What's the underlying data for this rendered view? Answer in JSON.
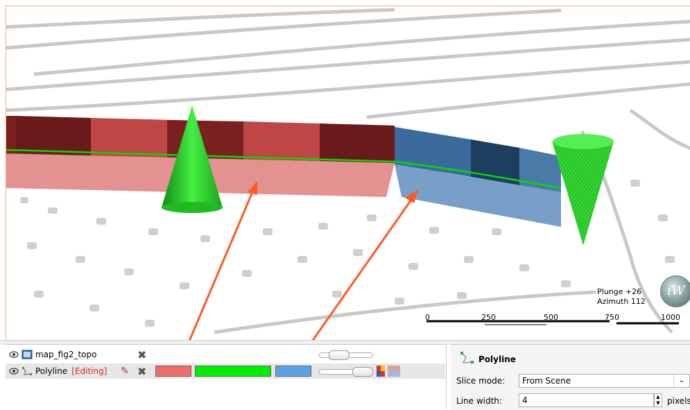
{
  "scene": {
    "compass": {
      "plunge": "Plunge +26",
      "azimuth": "Azimuth 112"
    },
    "scale_bar": {
      "labels": [
        "0",
        "250",
        "500",
        "750",
        "1000"
      ]
    },
    "logo_text": "iW",
    "colors": {
      "red_segment": "#c84a4a",
      "blue_segment": "#4a7aa8",
      "cone": "#22dd22",
      "annotation_arrow": "#ff5a1f"
    }
  },
  "layers": [
    {
      "name": "map_fig2_topo",
      "icon": "map-icon",
      "editing": ""
    },
    {
      "name": "Polyline",
      "icon": "polyline-icon",
      "editing": "[Editing]",
      "swatches": {
        "left": "#f26b6b",
        "line": "#00ee00",
        "right": "#5aa2e6"
      }
    }
  ],
  "properties": {
    "title": "Polyline",
    "slice_mode_label": "Slice mode:",
    "slice_mode_value": "From Scene",
    "line_width_label": "Line width:",
    "line_width_value": "4",
    "line_width_unit": "pixels"
  }
}
